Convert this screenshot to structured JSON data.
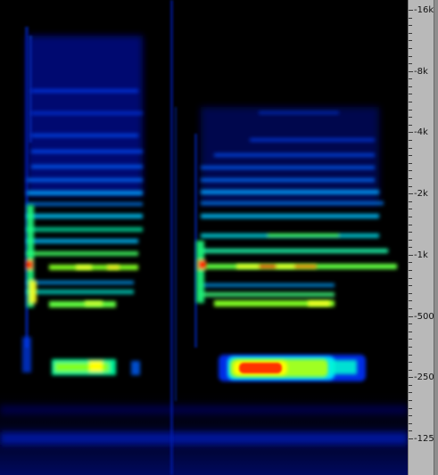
{
  "freq_axis": {
    "labels": [
      {
        "text": "-16k",
        "hz": 16000
      },
      {
        "text": "-8k",
        "hz": 8000
      },
      {
        "text": "-4k",
        "hz": 4000
      },
      {
        "text": "-2k",
        "hz": 2000
      },
      {
        "text": "-1k",
        "hz": 1000
      },
      {
        "text": "-500",
        "hz": 500
      },
      {
        "text": "-250",
        "hz": 250
      },
      {
        "text": "-125",
        "hz": 125
      }
    ],
    "scale": "log"
  },
  "colors": {
    "background": "#000000",
    "ruler": "#b9b9b9",
    "colormap": [
      "#000000",
      "#0000c8",
      "#0050ff",
      "#00ff40",
      "#ffff00",
      "#ff3000"
    ]
  }
}
